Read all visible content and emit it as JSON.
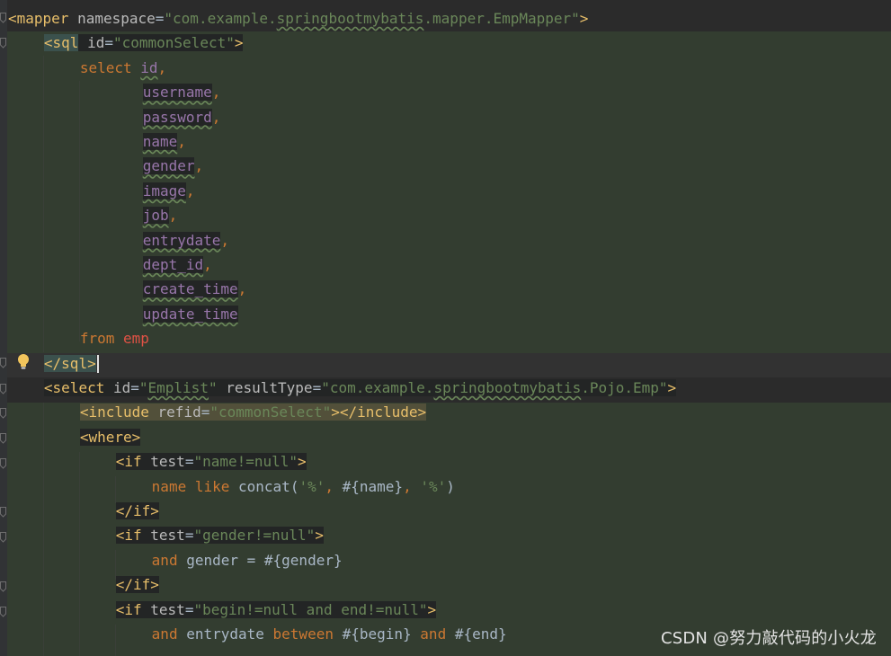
{
  "editor": {
    "language": "XML (MyBatis mapper)",
    "lines": [
      {
        "indent": 0,
        "tokens": [
          {
            "t": "<mapper ",
            "c": "tag"
          },
          {
            "t": "namespace",
            "c": "attr"
          },
          {
            "t": "=",
            "c": "plain"
          },
          {
            "t": "\"com.example.",
            "c": "str"
          },
          {
            "t": "springbootmybatis",
            "c": "str squig"
          },
          {
            "t": ".mapper.EmpMapper\"",
            "c": "str"
          },
          {
            "t": ">",
            "c": "tag"
          }
        ]
      },
      {
        "indent": 4,
        "tokens": [
          {
            "t": "<sql",
            "c": "tag hl-tag"
          },
          {
            "t": " ",
            "c": "plain hl-dark"
          },
          {
            "t": "id",
            "c": "attr hl-dark"
          },
          {
            "t": "=",
            "c": "plain hl-dark"
          },
          {
            "t": "\"commonSelect\"",
            "c": "str hl-dark"
          },
          {
            "t": ">",
            "c": "tag hl-dark"
          }
        ]
      },
      {
        "indent": 8,
        "tokens": [
          {
            "t": "select ",
            "c": "kw"
          },
          {
            "t": "id",
            "c": "col"
          },
          {
            "t": ",",
            "c": "kw"
          }
        ]
      },
      {
        "indent": 15,
        "tokens": [
          {
            "t": "username",
            "c": "col hl-dark"
          },
          {
            "t": ",",
            "c": "kw"
          }
        ]
      },
      {
        "indent": 15,
        "tokens": [
          {
            "t": "password",
            "c": "col hl-dark"
          },
          {
            "t": ",",
            "c": "kw"
          }
        ]
      },
      {
        "indent": 15,
        "tokens": [
          {
            "t": "name",
            "c": "col hl-dark"
          },
          {
            "t": ",",
            "c": "kw"
          }
        ]
      },
      {
        "indent": 15,
        "tokens": [
          {
            "t": "gender",
            "c": "col hl-dark"
          },
          {
            "t": ",",
            "c": "kw"
          }
        ]
      },
      {
        "indent": 15,
        "tokens": [
          {
            "t": "image",
            "c": "col hl-dark"
          },
          {
            "t": ",",
            "c": "kw"
          }
        ]
      },
      {
        "indent": 15,
        "tokens": [
          {
            "t": "job",
            "c": "col hl-dark"
          },
          {
            "t": ",",
            "c": "kw"
          }
        ]
      },
      {
        "indent": 15,
        "tokens": [
          {
            "t": "entrydate",
            "c": "col hl-dark"
          },
          {
            "t": ",",
            "c": "kw"
          }
        ]
      },
      {
        "indent": 15,
        "tokens": [
          {
            "t": "dept_id",
            "c": "col hl-dark"
          },
          {
            "t": ",",
            "c": "kw"
          }
        ]
      },
      {
        "indent": 15,
        "tokens": [
          {
            "t": "create_time",
            "c": "col hl-dark"
          },
          {
            "t": ",",
            "c": "kw"
          }
        ]
      },
      {
        "indent": 15,
        "tokens": [
          {
            "t": "update_time",
            "c": "col hl-dark"
          }
        ]
      },
      {
        "indent": 8,
        "tokens": [
          {
            "t": "from ",
            "c": "kw"
          },
          {
            "t": "emp",
            "c": "tbl"
          }
        ]
      },
      {
        "indent": 4,
        "tokens": [
          {
            "t": "</sql>",
            "c": "tag hl-tag"
          }
        ],
        "caret": true
      },
      {
        "indent": 4,
        "tokens": [
          {
            "t": "<select ",
            "c": "tag hl-dark"
          },
          {
            "t": "id",
            "c": "attr hl-dark"
          },
          {
            "t": "=",
            "c": "plain hl-dark"
          },
          {
            "t": "\"",
            "c": "str hl-dark"
          },
          {
            "t": "Emplist",
            "c": "str squig hl-dark"
          },
          {
            "t": "\"",
            "c": "str hl-dark"
          },
          {
            "t": " ",
            "c": "plain hl-dark"
          },
          {
            "t": "resultType",
            "c": "attr hl-dark"
          },
          {
            "t": "=",
            "c": "plain hl-dark"
          },
          {
            "t": "\"com.example.",
            "c": "str hl-dark"
          },
          {
            "t": "springbootmybatis",
            "c": "str squig hl-dark"
          },
          {
            "t": ".Pojo.Emp\"",
            "c": "str hl-dark"
          },
          {
            "t": ">",
            "c": "tag hl-dark"
          }
        ]
      },
      {
        "indent": 8,
        "tokens": [
          {
            "t": "<include ",
            "c": "tag hl-include"
          },
          {
            "t": "refid",
            "c": "attr hl-include"
          },
          {
            "t": "=",
            "c": "plain hl-include"
          },
          {
            "t": "\"commonSelect\"",
            "c": "str hl-include"
          },
          {
            "t": "></include>",
            "c": "tag hl-include"
          }
        ]
      },
      {
        "indent": 8,
        "tokens": [
          {
            "t": "<where>",
            "c": "tag hl-dark"
          }
        ]
      },
      {
        "indent": 12,
        "tokens": [
          {
            "t": "<if ",
            "c": "tag hl-dark"
          },
          {
            "t": "test",
            "c": "attr hl-dark"
          },
          {
            "t": "=",
            "c": "plain hl-dark"
          },
          {
            "t": "\"name!=null\"",
            "c": "str hl-dark"
          },
          {
            "t": ">",
            "c": "tag hl-dark"
          }
        ]
      },
      {
        "indent": 16,
        "tokens": [
          {
            "t": "name ",
            "c": "kw"
          },
          {
            "t": "like ",
            "c": "kw"
          },
          {
            "t": "concat(",
            "c": "plain"
          },
          {
            "t": "'%'",
            "c": "str"
          },
          {
            "t": ", ",
            "c": "kw"
          },
          {
            "t": "#{name}",
            "c": "plain"
          },
          {
            "t": ", ",
            "c": "kw"
          },
          {
            "t": "'%'",
            "c": "str"
          },
          {
            "t": ")",
            "c": "plain"
          }
        ]
      },
      {
        "indent": 12,
        "tokens": [
          {
            "t": "</if>",
            "c": "tag hl-dark"
          }
        ]
      },
      {
        "indent": 12,
        "tokens": [
          {
            "t": "<if ",
            "c": "tag hl-dark"
          },
          {
            "t": "test",
            "c": "attr hl-dark"
          },
          {
            "t": "=",
            "c": "plain hl-dark"
          },
          {
            "t": "\"gender!=null\"",
            "c": "str hl-dark"
          },
          {
            "t": ">",
            "c": "tag hl-dark"
          }
        ]
      },
      {
        "indent": 16,
        "tokens": [
          {
            "t": "and ",
            "c": "kw"
          },
          {
            "t": "gender = #{gender}",
            "c": "plain"
          }
        ]
      },
      {
        "indent": 12,
        "tokens": [
          {
            "t": "</if>",
            "c": "tag hl-dark"
          }
        ]
      },
      {
        "indent": 12,
        "tokens": [
          {
            "t": "<if ",
            "c": "tag hl-dark"
          },
          {
            "t": "test",
            "c": "attr hl-dark"
          },
          {
            "t": "=",
            "c": "plain hl-dark"
          },
          {
            "t": "\"begin!=null and end!=null\"",
            "c": "str hl-dark"
          },
          {
            "t": ">",
            "c": "tag hl-dark"
          }
        ]
      },
      {
        "indent": 16,
        "tokens": [
          {
            "t": "and ",
            "c": "kw"
          },
          {
            "t": "entrydate ",
            "c": "plain"
          },
          {
            "t": "between ",
            "c": "kw"
          },
          {
            "t": "#{begin} ",
            "c": "plain"
          },
          {
            "t": "and ",
            "c": "kw"
          },
          {
            "t": "#{end}",
            "c": "plain"
          }
        ]
      }
    ]
  },
  "watermark": "CSDN @努力敲代码的小火龙",
  "colors": {
    "background": "#2b2b2b",
    "injected_block": "#333d30",
    "tag": "#e8bf6a",
    "attribute": "#bababa",
    "string": "#6a8759",
    "keyword": "#cc7832",
    "column": "#9876aa",
    "table": "#e05245"
  },
  "icons": [
    "fold-marker-icon",
    "intention-bulb-icon"
  ]
}
